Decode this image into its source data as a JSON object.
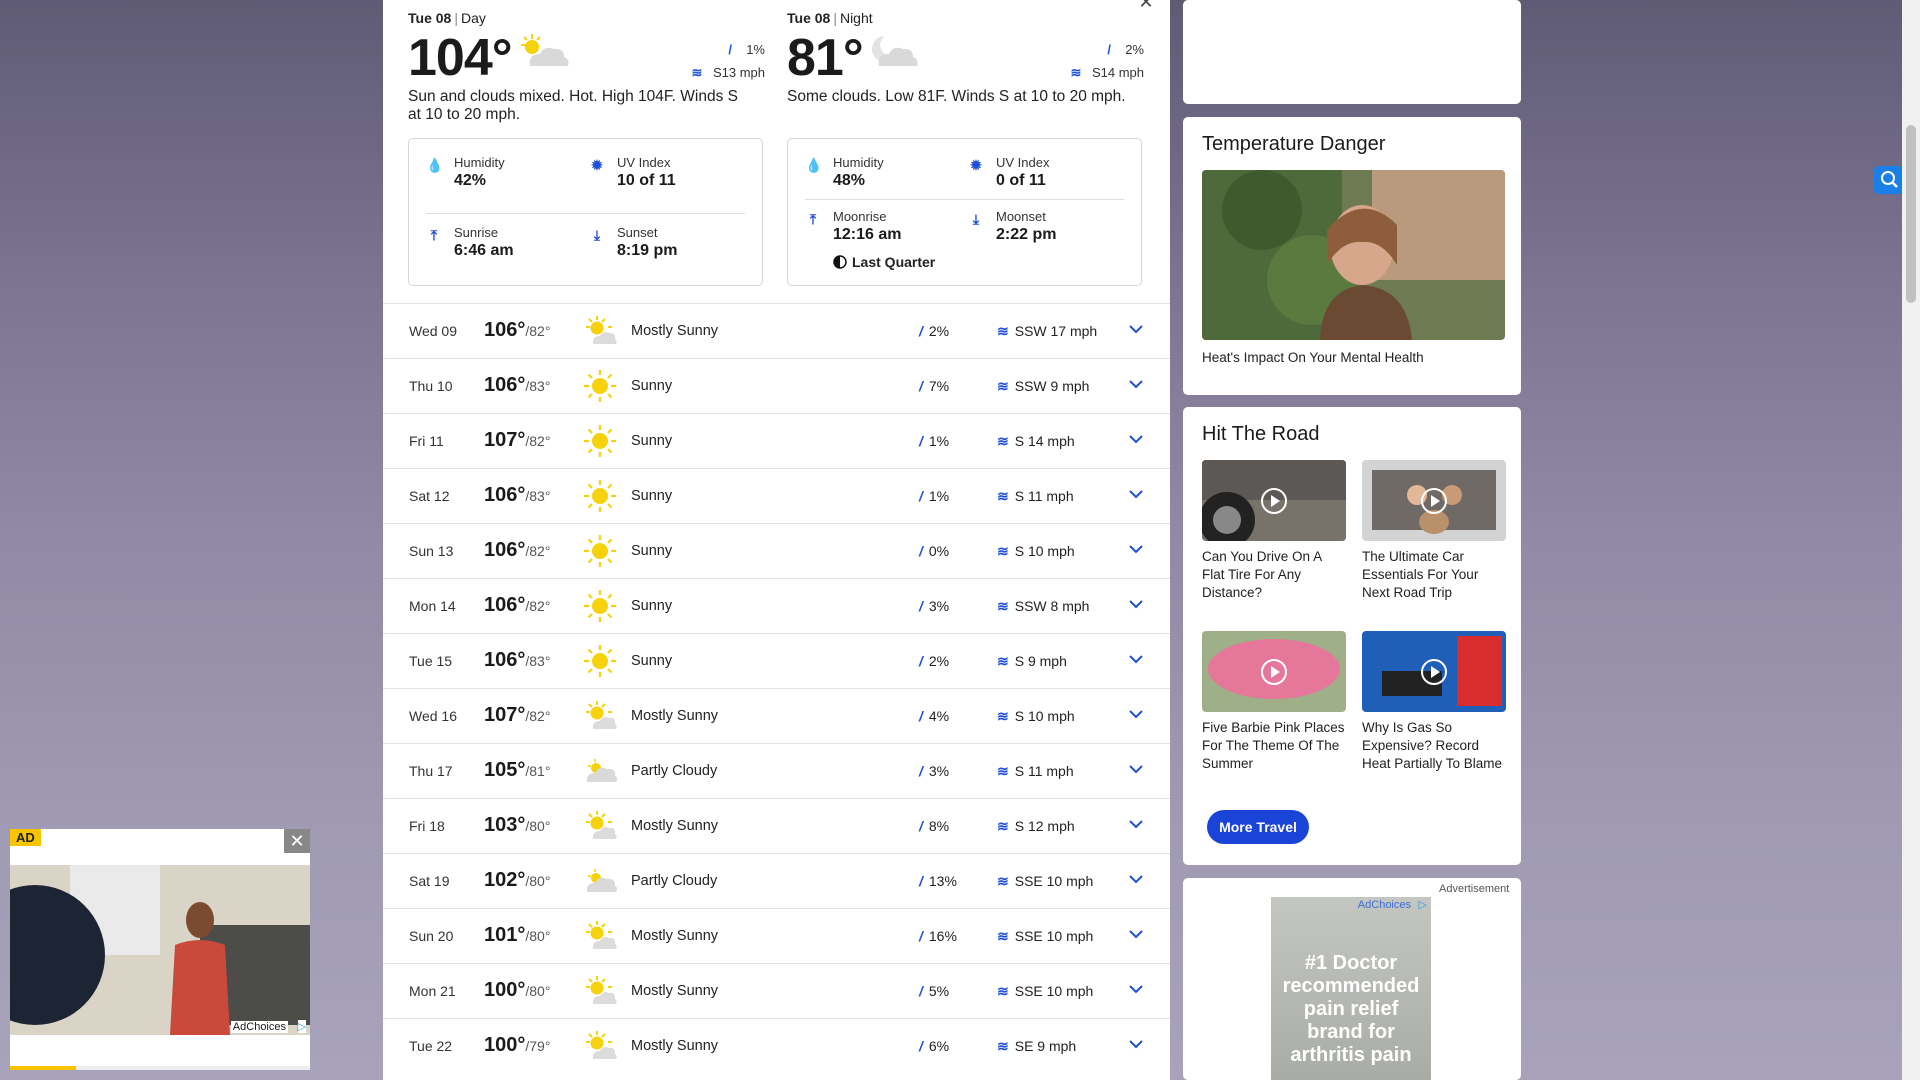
{
  "day": {
    "date": "Tue 08",
    "part": "Day",
    "temp": "104°",
    "precip": "1%",
    "wind": "S13 mph",
    "summary": "Sun and clouds mixed. Hot. High 104F. Winds S at 10 to 20 mph.",
    "humidity_label": "Humidity",
    "humidity": "42%",
    "uv_label": "UV Index",
    "uv": "10 of 11",
    "sunrise_label": "Sunrise",
    "sunrise": "6:46 am",
    "sunset_label": "Sunset",
    "sunset": "8:19 pm"
  },
  "night": {
    "date": "Tue 08",
    "part": "Night",
    "temp": "81°",
    "precip": "2%",
    "wind": "S14 mph",
    "summary": "Some clouds. Low 81F. Winds S at 10 to 20 mph.",
    "humidity_label": "Humidity",
    "humidity": "48%",
    "uv_label": "UV Index",
    "uv": "0 of 11",
    "moonrise_label": "Moonrise",
    "moonrise": "12:16 am",
    "moonset_label": "Moonset",
    "moonset": "2:22 pm",
    "moon_phase": "Last Quarter"
  },
  "forecast": [
    {
      "date": "Wed 09",
      "hi": "106°",
      "lo": "/82°",
      "icon": "mostly-sunny",
      "cond": "Mostly Sunny",
      "precip": "2%",
      "wind": "SSW 17 mph"
    },
    {
      "date": "Thu 10",
      "hi": "106°",
      "lo": "/83°",
      "icon": "sunny",
      "cond": "Sunny",
      "precip": "7%",
      "wind": "SSW 9 mph"
    },
    {
      "date": "Fri 11",
      "hi": "107°",
      "lo": "/82°",
      "icon": "sunny",
      "cond": "Sunny",
      "precip": "1%",
      "wind": "S 14 mph"
    },
    {
      "date": "Sat 12",
      "hi": "106°",
      "lo": "/83°",
      "icon": "sunny",
      "cond": "Sunny",
      "precip": "1%",
      "wind": "S 11 mph"
    },
    {
      "date": "Sun 13",
      "hi": "106°",
      "lo": "/82°",
      "icon": "sunny",
      "cond": "Sunny",
      "precip": "0%",
      "wind": "S 10 mph"
    },
    {
      "date": "Mon 14",
      "hi": "106°",
      "lo": "/82°",
      "icon": "sunny",
      "cond": "Sunny",
      "precip": "3%",
      "wind": "SSW 8 mph"
    },
    {
      "date": "Tue 15",
      "hi": "106°",
      "lo": "/83°",
      "icon": "sunny",
      "cond": "Sunny",
      "precip": "2%",
      "wind": "S 9 mph"
    },
    {
      "date": "Wed 16",
      "hi": "107°",
      "lo": "/82°",
      "icon": "mostly-sunny",
      "cond": "Mostly Sunny",
      "precip": "4%",
      "wind": "S 10 mph"
    },
    {
      "date": "Thu 17",
      "hi": "105°",
      "lo": "/81°",
      "icon": "partly-cloudy",
      "cond": "Partly Cloudy",
      "precip": "3%",
      "wind": "S 11 mph"
    },
    {
      "date": "Fri 18",
      "hi": "103°",
      "lo": "/80°",
      "icon": "mostly-sunny",
      "cond": "Mostly Sunny",
      "precip": "8%",
      "wind": "S 12 mph"
    },
    {
      "date": "Sat 19",
      "hi": "102°",
      "lo": "/80°",
      "icon": "partly-cloudy",
      "cond": "Partly Cloudy",
      "precip": "13%",
      "wind": "SSE 10 mph"
    },
    {
      "date": "Sun 20",
      "hi": "101°",
      "lo": "/80°",
      "icon": "mostly-sunny",
      "cond": "Mostly Sunny",
      "precip": "16%",
      "wind": "SSE 10 mph"
    },
    {
      "date": "Mon 21",
      "hi": "100°",
      "lo": "/80°",
      "icon": "mostly-sunny",
      "cond": "Mostly Sunny",
      "precip": "5%",
      "wind": "SSE 10 mph"
    },
    {
      "date": "Tue 22",
      "hi": "100°",
      "lo": "/79°",
      "icon": "mostly-sunny",
      "cond": "Mostly Sunny",
      "precip": "6%",
      "wind": "SE 9 mph"
    }
  ],
  "temp_danger": {
    "title": "Temperature Danger",
    "caption": "Heat's Impact On Your Mental Health"
  },
  "hit_the_road": {
    "title": "Hit The Road",
    "items": [
      {
        "caption": "Can You Drive On A Flat Tire For Any Distance?"
      },
      {
        "caption": "The Ultimate Car Essentials For Your Next Road Trip"
      },
      {
        "caption": "Five Barbie Pink Places For The Theme Of The Summer"
      },
      {
        "caption": "Why Is Gas So Expensive? Record Heat Partially To Blame"
      }
    ],
    "more_button": "More Travel"
  },
  "sidebar_ad": {
    "label": "Advertisement",
    "adchoices": "AdChoices",
    "headline": "#1 Doctor recommended pain relief brand for arthritis pain"
  },
  "video_ad": {
    "badge": "AD",
    "adchoices": "AdChoices",
    "progress": 0.22
  },
  "colors": {
    "accent": "#1a44d8",
    "sun": "#f5d20b",
    "icon_blue": "#1f4fd6",
    "ad_yellow": "#f7c400"
  }
}
